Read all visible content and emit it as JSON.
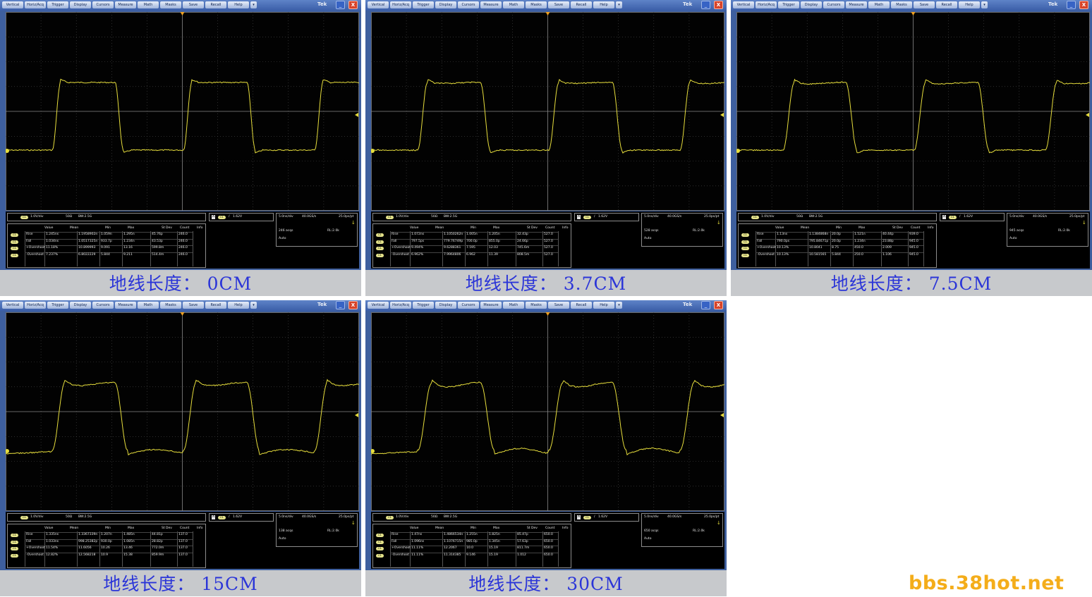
{
  "menu": [
    "Vertical",
    "Horiz/Acq",
    "Trigger",
    "Display",
    "Cursors",
    "Measure",
    "Math",
    "Masks",
    "Save",
    "Recall",
    "Help"
  ],
  "menu_arrow": "▾",
  "brand": "Tek",
  "win_min": "_",
  "win_close": "X",
  "icons": {
    "minimize": "minimize-icon",
    "close": "close-icon",
    "trigger": "trigger-arrow-icon",
    "ground": "ground-marker-icon"
  },
  "colors": {
    "trace": "#e6dd3c",
    "grid": "#5a5a5a",
    "caption": "#2b35d8",
    "watermark": "#f4ad1a"
  },
  "watermark": "bbs.38hot.net",
  "headers": [
    "Value",
    "Mean",
    "Min",
    "Max",
    "St Dev",
    "Count",
    "Info"
  ],
  "panels": [
    {
      "caption": "地线长度： 0CM",
      "ch": {
        "badge": "C1",
        "scale": "1.0V/div",
        "imp": "50Ω",
        "bw": "BW:2.5G"
      },
      "trig": {
        "mode": "A",
        "badge": "C1",
        "slope": "/",
        "level": "1.62V"
      },
      "time": {
        "div": "5.0ns/div",
        "rate": "40.0GS/s",
        "res": "25.0ps/pt",
        "acqs": "246 acqs",
        "rl": "RL:2.0k",
        "mode": "Auto"
      },
      "meas": [
        {
          "badge": "C1",
          "name": "Rise",
          "value": "1.245ns",
          "mean": "1.1958902n",
          "min": "1.059n",
          "max": "1.295n",
          "std": "45.76p",
          "count": "246.0"
        },
        {
          "badge": "C1",
          "name": "Fall",
          "value": "1.034ns",
          "mean": "1.0517325n",
          "min": "933.7p",
          "max": "1.234n",
          "std": "43.53p",
          "count": "246.0"
        },
        {
          "badge": "C1",
          "name": "+Overshoot",
          "value": "11.18%",
          "mean": "10.899993",
          "min": "9.091",
          "max": "13.16",
          "std": "599.8m",
          "count": "246.0"
        },
        {
          "badge": "C1",
          "name": "-Overshoot",
          "value": "7.237%",
          "mean": "6.8022229",
          "min": "5.844",
          "max": "9.211",
          "std": "514.4m",
          "count": "246.0"
        }
      ]
    },
    {
      "caption": "地线长度： 3.7CM",
      "ch": {
        "badge": "C1",
        "scale": "1.0V/div",
        "imp": "50Ω",
        "bw": "BW:2.5G"
      },
      "trig": {
        "mode": "A",
        "badge": "C1",
        "slope": "/",
        "level": "1.62V"
      },
      "time": {
        "div": "5.0ns/div",
        "rate": "40.0GS/s",
        "res": "25.0ps/pt",
        "acqs": "528 acqs",
        "rl": "RL:2.0k",
        "mode": "Auto"
      },
      "meas": [
        {
          "badge": "C1",
          "name": "Rise",
          "value": "1.072ns",
          "mean": "1.1050262n",
          "min": "1.005n",
          "max": "1.205n",
          "std": "32.43p",
          "count": "527.0"
        },
        {
          "badge": "C1",
          "name": "Fall",
          "value": "797.5ps",
          "mean": "779.76749p",
          "min": "700.0p",
          "max": "855.0p",
          "std": "24.66p",
          "count": "527.0"
        },
        {
          "badge": "C1",
          "name": "+Overshoot",
          "value": "9.494%",
          "mean": "9.6288361",
          "min": "7.595",
          "max": "12.03",
          "std": "745.6m",
          "count": "527.0"
        },
        {
          "badge": "C1",
          "name": "-Overshoot",
          "value": "6.962%",
          "mean": "7.9964806",
          "min": "6.962",
          "max": "11.39",
          "std": "808.5m",
          "count": "527.0"
        }
      ]
    },
    {
      "caption": "地线长度： 7.5CM",
      "ch": {
        "badge": "C1",
        "scale": "1.0V/div",
        "imp": "50Ω",
        "bw": "BW:2.5G"
      },
      "trig": {
        "mode": "A",
        "badge": "C1",
        "slope": "/",
        "level": "1.62V"
      },
      "time": {
        "div": "5.0ns/div",
        "rate": "40.0GS/s",
        "res": "25.0ps/pt",
        "acqs": "945 acqs",
        "rl": "RL:2.0k",
        "mode": "Auto"
      },
      "meas": [
        {
          "badge": "C1",
          "name": "Rise",
          "value": "1.13ns",
          "mean": "1.1384868n",
          "min": "20.0p",
          "max": "1.521n",
          "std": "40.44p",
          "count": "939.0"
        },
        {
          "badge": "C1",
          "name": "Fall",
          "value": "790.0ps",
          "mean": "795.84671p",
          "min": "20.0p",
          "max": "1.234n",
          "std": "23.88p",
          "count": "945.0"
        },
        {
          "badge": "C1",
          "name": "+Overshoot",
          "value": "10.13%",
          "mean": "10.8041",
          "min": "8.75",
          "max": "450.0",
          "std": "2.009",
          "count": "945.0"
        },
        {
          "badge": "C1",
          "name": "-Overshoot",
          "value": "10.13%",
          "mean": "10.581565",
          "min": "5.844",
          "max": "250.0",
          "std": "1.106",
          "count": "945.0"
        }
      ]
    },
    {
      "caption": "地线长度： 15CM",
      "ch": {
        "badge": "C1",
        "scale": "1.0V/div",
        "imp": "50Ω",
        "bw": "BW:2.5G"
      },
      "trig": {
        "mode": "A",
        "badge": "C1",
        "slope": "/",
        "level": "1.62V"
      },
      "time": {
        "div": "5.0ns/div",
        "rate": "40.0GS/s",
        "res": "25.0ps/pt",
        "acqs": "138 acqs",
        "rl": "RL:2.0k",
        "mode": "Auto"
      },
      "meas": [
        {
          "badge": "C1",
          "name": "Rise",
          "value": "1.335ns",
          "mean": "1.3367339n",
          "min": "1.207n",
          "max": "1.485n",
          "std": "44.81p",
          "count": "137.0"
        },
        {
          "badge": "C1",
          "name": "Fall",
          "value": "1.033ns",
          "mean": "998.25382p",
          "min": "930.0p",
          "max": "1.085n",
          "std": "28.82p",
          "count": "137.0"
        },
        {
          "badge": "C1",
          "name": "+Overshoot",
          "value": "11.54%",
          "mean": "11.6056",
          "min": "10.26",
          "max": "13.46",
          "std": "772.0m",
          "count": "137.0"
        },
        {
          "badge": "C1",
          "name": "-Overshoot",
          "value": "12.82%",
          "mean": "12.568218",
          "min": "10.9",
          "max": "15.38",
          "std": "859.9m",
          "count": "137.0"
        }
      ]
    },
    {
      "caption": "地线长度： 30CM",
      "ch": {
        "badge": "C1",
        "scale": "1.0V/div",
        "imp": "50Ω",
        "bw": "BW:2.5G"
      },
      "trig": {
        "mode": "A",
        "badge": "C1",
        "slope": "/",
        "level": "1.62V"
      },
      "time": {
        "div": "5.0ns/div",
        "rate": "40.0GS/s",
        "res": "25.0ps/pt",
        "acqs": "650 acqs",
        "rl": "RL:2.0k",
        "mode": "Auto"
      },
      "meas": [
        {
          "badge": "C1",
          "name": "Rise",
          "value": "1.47ns",
          "mean": "1.4866534n",
          "min": "1.255n",
          "max": "1.825n",
          "std": "85.47p",
          "count": "650.0"
        },
        {
          "badge": "C1",
          "name": "Fall",
          "value": "1.096ns",
          "mean": "1.1076715n",
          "min": "985.0p",
          "max": "1.345n",
          "std": "57.63p",
          "count": "650.0"
        },
        {
          "badge": "C1",
          "name": "+Overshoot",
          "value": "11.11%",
          "mean": "12.2067",
          "min": "10.0",
          "max": "15.19",
          "std": "811.7m",
          "count": "650.0"
        },
        {
          "badge": "C1",
          "name": "-Overshoot",
          "value": "11.11%",
          "mean": "11.314385",
          "min": "9.146",
          "max": "15.19",
          "std": "1.012",
          "count": "650.0"
        }
      ]
    }
  ]
}
